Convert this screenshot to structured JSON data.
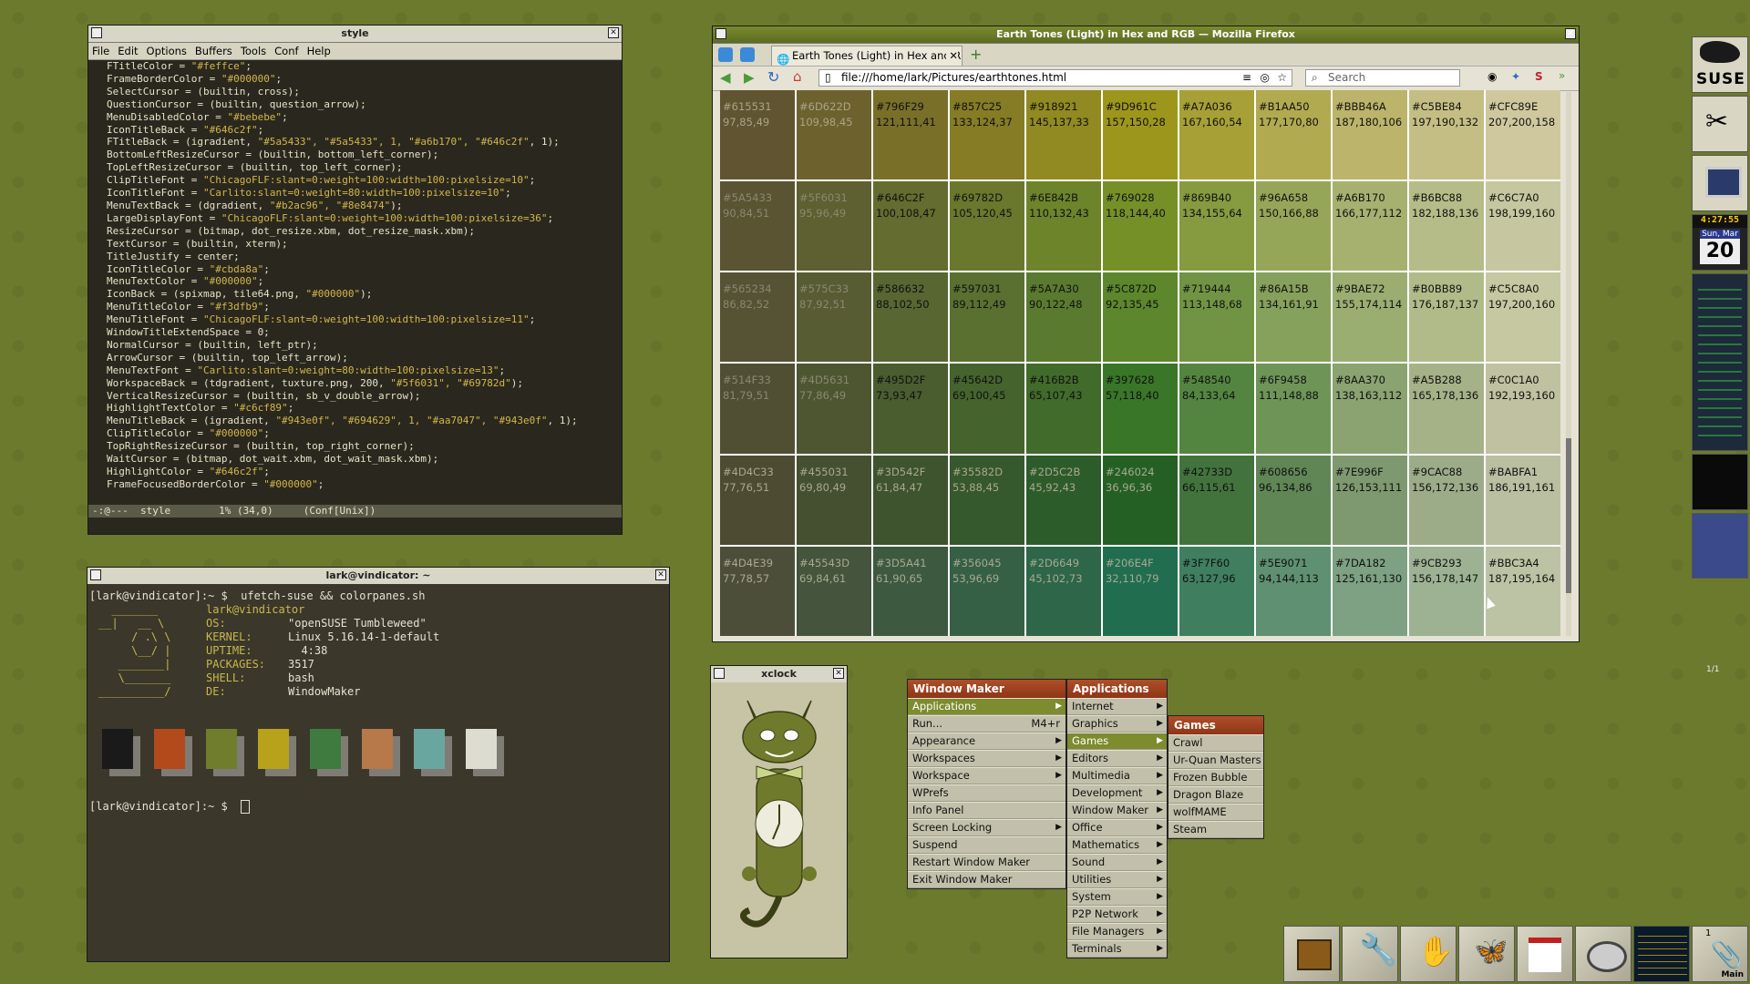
{
  "emacs": {
    "title": "style",
    "menu": [
      "File",
      "Edit",
      "Options",
      "Buffers",
      "Tools",
      "Conf",
      "Help"
    ],
    "lines": [
      [
        "FTitleColor = ",
        "\"#feffce\"",
        ";"
      ],
      [
        "FrameBorderColor = ",
        "\"#000000\"",
        ";"
      ],
      [
        "SelectCursor = (builtin, cross);",
        "",
        ""
      ],
      [
        "QuestionCursor = (builtin, question_arrow);",
        "",
        ""
      ],
      [
        "MenuDisabledColor = ",
        "\"#bebebe\"",
        ";"
      ],
      [
        "IconTitleBack = ",
        "\"#646c2f\"",
        ";"
      ],
      [
        "FTitleBack = (igradient, ",
        "\"#5a5433\", \"#5a5433\", 1, \"#a6b170\", \"#646c2f\"",
        ", 1);"
      ],
      [
        "BottomLeftResizeCursor = (builtin, bottom_left_corner);",
        "",
        ""
      ],
      [
        "TopLeftResizeCursor = (builtin, top_left_corner);",
        "",
        ""
      ],
      [
        "ClipTitleFont = ",
        "\"ChicagoFLF:slant=0:weight=100:width=100:pixelsize=10\"",
        ";"
      ],
      [
        "IconTitleFont = ",
        "\"Carlito:slant=0:weight=80:width=100:pixelsize=10\"",
        ";"
      ],
      [
        "MenuTextBack = (dgradient, ",
        "\"#b2ac96\", \"#8e8474\"",
        ");"
      ],
      [
        "LargeDisplayFont = ",
        "\"ChicagoFLF:slant=0:weight=100:width=100:pixelsize=36\"",
        ";"
      ],
      [
        "ResizeCursor = (bitmap, dot_resize.xbm, dot_resize_mask.xbm);",
        "",
        ""
      ],
      [
        "TextCursor = (builtin, xterm);",
        "",
        ""
      ],
      [
        "TitleJustify = center;",
        "",
        ""
      ],
      [
        "IconTitleColor = ",
        "\"#cbda8a\"",
        ";"
      ],
      [
        "MenuTextColor = ",
        "\"#000000\"",
        ";"
      ],
      [
        "IconBack = (spixmap, tile64.png, ",
        "\"#000000\"",
        ");"
      ],
      [
        "MenuTitleColor = ",
        "\"#f3dfb9\"",
        ";"
      ],
      [
        "MenuTitleFont = ",
        "\"ChicagoFLF:slant=0:weight=100:width=100:pixelsize=11\"",
        ";"
      ],
      [
        "WindowTitleExtendSpace = 0;",
        "",
        ""
      ],
      [
        "NormalCursor = (builtin, left_ptr);",
        "",
        ""
      ],
      [
        "ArrowCursor = (builtin, top_left_arrow);",
        "",
        ""
      ],
      [
        "MenuTextFont = ",
        "\"Carlito:slant=0:weight=80:width=100:pixelsize=13\"",
        ";"
      ],
      [
        "WorkspaceBack = (tdgradient, tuxture.png, 200, ",
        "\"#5f6031\", \"#69782d\"",
        ");"
      ],
      [
        "VerticalResizeCursor = (builtin, sb_v_double_arrow);",
        "",
        ""
      ],
      [
        "HighlightTextColor = ",
        "\"#c6cf89\"",
        ";"
      ],
      [
        "MenuTitleBack = (igradient, ",
        "\"#943e0f\", \"#694629\", 1, \"#aa7047\", \"#943e0f\"",
        ", 1);"
      ],
      [
        "ClipTitleColor = ",
        "\"#000000\"",
        ";"
      ],
      [
        "TopRightResizeCursor = (builtin, top_right_corner);",
        "",
        ""
      ],
      [
        "WaitCursor = (bitmap, dot_wait.xbm, dot_wait_mask.xbm);",
        "",
        ""
      ],
      [
        "HighlightColor = ",
        "\"#646c2f\"",
        ";"
      ],
      [
        "FrameFocusedBorderColor = ",
        "\"#000000\"",
        ";"
      ]
    ],
    "modeline": "-:@---  style        1% (34,0)     (Conf[Unix])"
  },
  "terminal": {
    "title": "lark@vindicator: ~",
    "prompt": "[lark@vindicator]:~ $",
    "command": "ufetch-suse && colorpanes.sh",
    "userhost": "lark@vindicator",
    "art": [
      "  _______",
      "__|   __ \\",
      "     / .\\ \\",
      "     \\__/ |",
      "   _______|",
      "   \\_______",
      "__________/"
    ],
    "info": [
      [
        "OS:",
        "\"openSUSE Tumbleweed\""
      ],
      [
        "KERNEL:",
        "Linux 5.16.14-1-default"
      ],
      [
        "UPTIME:",
        "  4:38"
      ],
      [
        "PACKAGES:",
        "3517"
      ],
      [
        "SHELL:",
        "bash"
      ],
      [
        "DE:",
        "WindowMaker"
      ]
    ],
    "panes": [
      "#1a1a1a",
      "#b34a1c",
      "#6f7d2c",
      "#b8a21c",
      "#3f7a3f",
      "#b7784a",
      "#6aa6a0",
      "#dcdcd0"
    ],
    "prompt2": "[lark@vindicator]:~ $"
  },
  "firefox": {
    "title": "Earth Tones (Light) in Hex and RGB — Mozilla Firefox",
    "tab": "Earth Tones (Light) in Hex and RG",
    "url": "file:///home/lark/Pictures/earthtones.html",
    "search": "Search",
    "rows": [
      [
        [
          "#615531",
          "97,85,49"
        ],
        [
          "#6D622D",
          "109,98,45"
        ],
        [
          "#796F29",
          "121,111,41"
        ],
        [
          "#857C25",
          "133,124,37"
        ],
        [
          "#918921",
          "145,137,33"
        ],
        [
          "#9D961C",
          "157,150,28"
        ],
        [
          "#A7A036",
          "167,160,54"
        ],
        [
          "#B1AA50",
          "177,170,80"
        ],
        [
          "#BBB46A",
          "187,180,106"
        ],
        [
          "#C5BE84",
          "197,190,132"
        ],
        [
          "#CFC89E",
          "207,200,158"
        ]
      ],
      [
        [
          "#5A5433",
          "90,84,51"
        ],
        [
          "#5F6031",
          "95,96,49"
        ],
        [
          "#646C2F",
          "100,108,47"
        ],
        [
          "#69782D",
          "105,120,45"
        ],
        [
          "#6E842B",
          "110,132,43"
        ],
        [
          "#769028",
          "118,144,40"
        ],
        [
          "#869B40",
          "134,155,64"
        ],
        [
          "#96A658",
          "150,166,88"
        ],
        [
          "#A6B170",
          "166,177,112"
        ],
        [
          "#B6BC88",
          "182,188,136"
        ],
        [
          "#C6C7A0",
          "198,199,160"
        ]
      ],
      [
        [
          "#565234",
          "86,82,52"
        ],
        [
          "#575C33",
          "87,92,51"
        ],
        [
          "#586632",
          "88,102,50"
        ],
        [
          "#597031",
          "89,112,49"
        ],
        [
          "#5A7A30",
          "90,122,48"
        ],
        [
          "#5C872D",
          "92,135,45"
        ],
        [
          "#719444",
          "113,148,68"
        ],
        [
          "#86A15B",
          "134,161,91"
        ],
        [
          "#9BAE72",
          "155,174,114"
        ],
        [
          "#B0BB89",
          "176,187,137"
        ],
        [
          "#C5C8A0",
          "197,200,160"
        ]
      ],
      [
        [
          "#514F33",
          "81,79,51"
        ],
        [
          "#4D5631",
          "77,86,49"
        ],
        [
          "#495D2F",
          "73,93,47"
        ],
        [
          "#45642D",
          "69,100,45"
        ],
        [
          "#416B2B",
          "65,107,43"
        ],
        [
          "#397628",
          "57,118,40"
        ],
        [
          "#548540",
          "84,133,64"
        ],
        [
          "#6F9458",
          "111,148,88"
        ],
        [
          "#8AA370",
          "138,163,112"
        ],
        [
          "#A5B288",
          "165,178,136"
        ],
        [
          "#C0C1A0",
          "192,193,160"
        ]
      ],
      [
        [
          "#4D4C33",
          "77,76,51"
        ],
        [
          "#455031",
          "69,80,49"
        ],
        [
          "#3D542F",
          "61,84,47"
        ],
        [
          "#35582D",
          "53,88,45"
        ],
        [
          "#2D5C2B",
          "45,92,43"
        ],
        [
          "#246024",
          "36,96,36"
        ],
        [
          "#42733D",
          "66,115,61"
        ],
        [
          "#608656",
          "96,134,86"
        ],
        [
          "#7E996F",
          "126,153,111"
        ],
        [
          "#9CAC88",
          "156,172,136"
        ],
        [
          "#BABFA1",
          "186,191,161"
        ]
      ],
      [
        [
          "#4D4E39",
          "77,78,57"
        ],
        [
          "#45543D",
          "69,84,61"
        ],
        [
          "#3D5A41",
          "61,90,65"
        ],
        [
          "#356045",
          "53,96,69"
        ],
        [
          "#2D6649",
          "45,102,73"
        ],
        [
          "#206E4F",
          "32,110,79"
        ],
        [
          "#3F7F60",
          "63,127,96"
        ],
        [
          "#5E9071",
          "94,144,113"
        ],
        [
          "#7DA182",
          "125,161,130"
        ],
        [
          "#9CB293",
          "156,178,147"
        ],
        [
          "#BBC3A4",
          "187,195,164"
        ]
      ]
    ]
  },
  "xclock": {
    "title": "xclock"
  },
  "wmmenu": {
    "title": "Window Maker",
    "items": [
      {
        "label": "Applications",
        "arrow": true,
        "sel": true
      },
      {
        "label": "Run...",
        "shortcut": "M4+r"
      },
      {
        "label": "Appearance",
        "arrow": true
      },
      {
        "label": "Workspaces",
        "arrow": true
      },
      {
        "label": "Workspace",
        "arrow": true
      },
      {
        "label": "WPrefs"
      },
      {
        "label": "Info Panel"
      },
      {
        "label": "Screen Locking",
        "arrow": true
      },
      {
        "label": "Suspend"
      },
      {
        "label": "Restart Window Maker"
      },
      {
        "label": "Exit Window Maker"
      }
    ]
  },
  "appmenu": {
    "title": "Applications",
    "items": [
      {
        "label": "Internet",
        "arrow": true
      },
      {
        "label": "Graphics",
        "arrow": true
      },
      {
        "label": "Games",
        "arrow": true,
        "sel": true
      },
      {
        "label": "Editors",
        "arrow": true
      },
      {
        "label": "Multimedia",
        "arrow": true
      },
      {
        "label": "Development",
        "arrow": true
      },
      {
        "label": "Window Maker",
        "arrow": true
      },
      {
        "label": "Office",
        "arrow": true
      },
      {
        "label": "Mathematics",
        "arrow": true
      },
      {
        "label": "Sound",
        "arrow": true
      },
      {
        "label": "Utilities",
        "arrow": true
      },
      {
        "label": "System",
        "arrow": true
      },
      {
        "label": "P2P Network",
        "arrow": true
      },
      {
        "label": "File Managers",
        "arrow": true
      },
      {
        "label": "Terminals",
        "arrow": true
      }
    ]
  },
  "gamesmenu": {
    "title": "Games",
    "items": [
      {
        "label": "Crawl"
      },
      {
        "label": "Ur-Quan Masters"
      },
      {
        "label": "Frozen Bubble"
      },
      {
        "label": "Dragon Blaze"
      },
      {
        "label": "wolfMAME"
      },
      {
        "label": "Steam"
      }
    ]
  },
  "dock": {
    "logo": "SUSE",
    "time": "4:27:55",
    "day": "Sun, Mar",
    "date": "20",
    "workspace": "1/1",
    "clip_label": "Main",
    "clip_num": "1"
  }
}
